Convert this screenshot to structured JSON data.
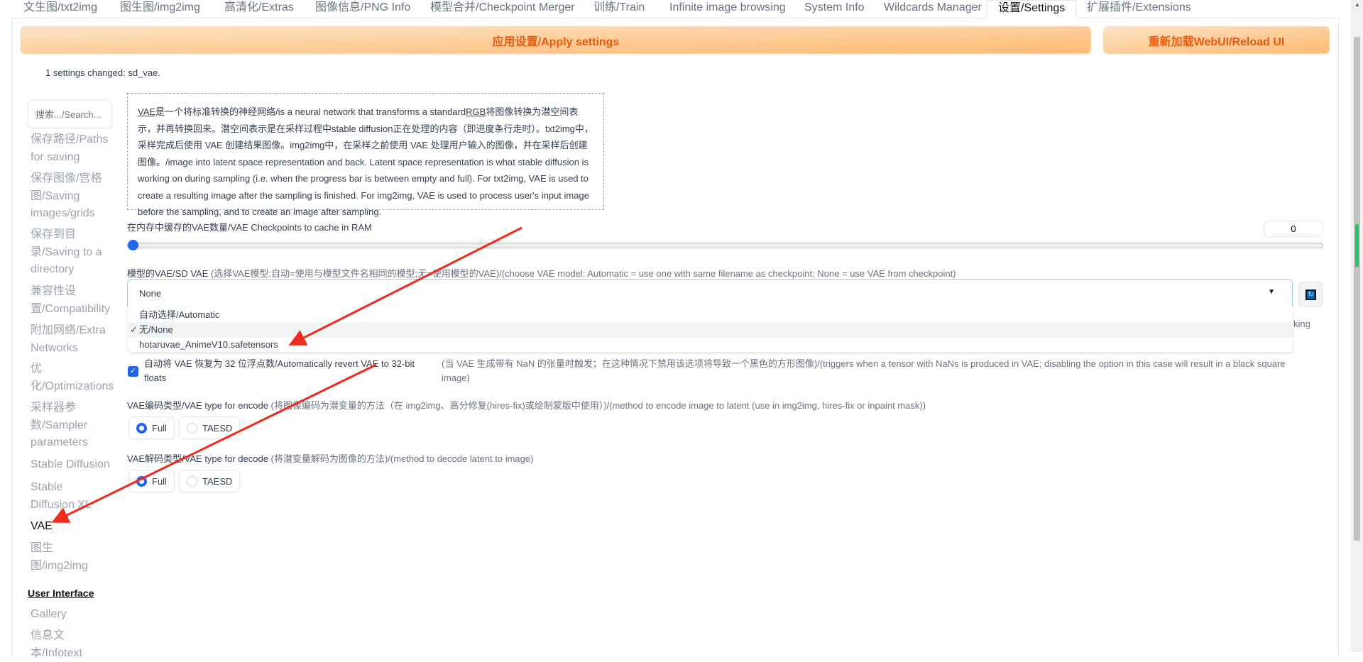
{
  "tabs": [
    {
      "label": "文生图/txt2img"
    },
    {
      "label": "图生图/img2img"
    },
    {
      "label": "高清化/Extras"
    },
    {
      "label": "图像信息/PNG Info"
    },
    {
      "label": "模型合并/Checkpoint Merger"
    },
    {
      "label": "训练/Train"
    },
    {
      "label": "Infinite image browsing"
    },
    {
      "label": "System Info"
    },
    {
      "label": "Wildcards Manager"
    },
    {
      "label": "设置/Settings",
      "active": true
    },
    {
      "label": "扩展插件/Extensions"
    }
  ],
  "toolbar": {
    "apply_label": "应用设置/Apply settings",
    "reload_label": "重新加载WebUI/Reload UI",
    "accent": "#ea580c"
  },
  "status": "1 settings changed: sd_vae.",
  "sidebar": {
    "search_placeholder": "搜索.../Search...",
    "items": [
      {
        "label": "保存路径/Paths for saving"
      },
      {
        "label": "保存图像/宫格图/Saving images/grids"
      },
      {
        "label": "保存到目录/Saving to a directory"
      },
      {
        "label": "兼容性设置/Compatibility"
      },
      {
        "label": "附加网络/Extra Networks"
      },
      {
        "label": "优化/Optimizations"
      },
      {
        "label": "采样器参数/Sampler parameters"
      },
      {
        "label": "Stable Diffusion"
      },
      {
        "label": "Stable Diffusion XL"
      },
      {
        "label": "VAE",
        "active": true
      },
      {
        "label": "图生图/img2img"
      }
    ],
    "section": "User Interface",
    "items2": [
      {
        "label": "Gallery"
      },
      {
        "label": "信息文本/Infotext"
      }
    ]
  },
  "description": {
    "vae_abbr": "VAE",
    "part1": "是一个将标准转换的神经网络/is a neural network that transforms a standard",
    "rgb_abbr": "RGB",
    "part2": "将图像转换为潜空间表示，并再转换回来。潜空间表示是在采样过程中stable diffusion正在处理的内容（即进度条行走时）。txt2img中，采样完成后使用 VAE 创建结果图像。img2img中，在采样之前使用 VAE 处理用户输入的图像，并在采样后创建图像。/image into latent space representation and back. Latent space representation is what stable diffusion is working on during sampling (i.e. when the progress bar is between empty and full). For txt2img, VAE is used to create a resulting image after the sampling is finished. For img2img, VAE is used to process user's input image before the sampling, and to create an image after sampling."
  },
  "cache": {
    "label": "在内存中缓存的VAE数量/VAE Checkpoints to cache in RAM",
    "value": "0",
    "slider_value": 0,
    "slider_min": 0
  },
  "sd_vae": {
    "label": "模型的VAE/SD VAE",
    "info": " (选择VAE模型:自动=使用与模型文件名相同的模型;无=使用模型的VAE)/(choose VAE model: Automatic = use one with same filename as checkpoint; None = use VAE from checkpoint)",
    "value": "None",
    "options": [
      {
        "label": "自动选择/Automatic"
      },
      {
        "label": "无/None",
        "checked": true
      },
      {
        "label": "hotaruvae_AnimeV10.safetensors"
      }
    ],
    "check_mark": "✓",
    "hidden_tail": "king"
  },
  "revert": {
    "checked": true,
    "label": "自动将 VAE 恢复为 32 位浮点数/Automatically revert VAE to 32-bit floats",
    "info": "(当 VAE 生成带有 NaN 的张量时触发；在这种情况下禁用该选项将导致一个黑色的方形图像)/(triggers when a tensor with NaNs is produced in VAE; disabling the option in this case will result in a black square image)"
  },
  "encode": {
    "label": "VAE编码类型/VAE type for encode",
    "info": " (将图像编码为潜变量的方法（在 img2img、高分修复(hires-fix)或绘制蒙版中使用）)/(method to encode image to latent (use in img2img, hires-fix or inpaint mask))",
    "options": [
      "Full",
      "TAESD"
    ],
    "selected": "Full"
  },
  "decode": {
    "label": "VAE解码类型/VAE type for decode",
    "info": " (将潜变量解码为图像的方法)/(method to decode latent to image)",
    "options": [
      "Full",
      "TAESD"
    ],
    "selected": "Full"
  },
  "annotation_color": "#ef2b1d"
}
